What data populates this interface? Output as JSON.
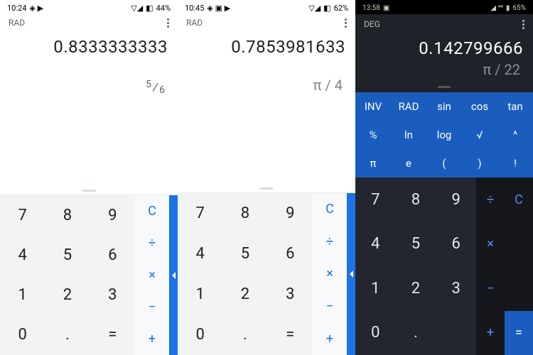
{
  "screens": [
    {
      "status": {
        "time": "10:24",
        "left_icons": "◈ ▶",
        "right_icons": "▽◢",
        "battery_icon": "◧",
        "battery": "44%"
      },
      "mode": "RAD",
      "result": "0.8333333333",
      "sub_expr": {
        "type": "fraction",
        "num": "5",
        "den": "6"
      },
      "keypad": [
        "7",
        "8",
        "9",
        "4",
        "5",
        "6",
        "1",
        "2",
        "3",
        "0",
        ".",
        "="
      ],
      "ops": [
        "C",
        "÷",
        "×",
        "−",
        "+"
      ]
    },
    {
      "status": {
        "time": "10:45",
        "left_icons": "◈ ▣ ▶",
        "right_icons": "▽◢",
        "battery_icon": "◧",
        "battery": "62%"
      },
      "mode": "RAD",
      "result": "0.7853981633",
      "sub_expr": {
        "type": "text",
        "value": "π / 4"
      },
      "keypad": [
        "7",
        "8",
        "9",
        "4",
        "5",
        "6",
        "1",
        "2",
        "3",
        "0",
        ".",
        "="
      ],
      "ops": [
        "C",
        "÷",
        "×",
        "−",
        "+"
      ]
    },
    {
      "status": {
        "time": "13:58",
        "left_icons": "▣",
        "right_icons": "◢ ⁴⁶",
        "battery_icon": "▮",
        "battery": "65%"
      },
      "mode": "DEG",
      "result": "0.142799666",
      "sub_expr": {
        "type": "text",
        "value": "π / 22"
      },
      "sci": [
        "INV",
        "RAD",
        "sin",
        "cos",
        "tan",
        "%",
        "ln",
        "log",
        "√",
        "^",
        "π",
        "e",
        "(",
        ")",
        "!"
      ],
      "keypad": [
        "7",
        "8",
        "9",
        "4",
        "5",
        "6",
        "1",
        "2",
        "3",
        "0",
        ".",
        ""
      ],
      "ops": [
        "÷",
        "C",
        "×",
        "",
        "−",
        "",
        "+",
        "="
      ]
    }
  ]
}
